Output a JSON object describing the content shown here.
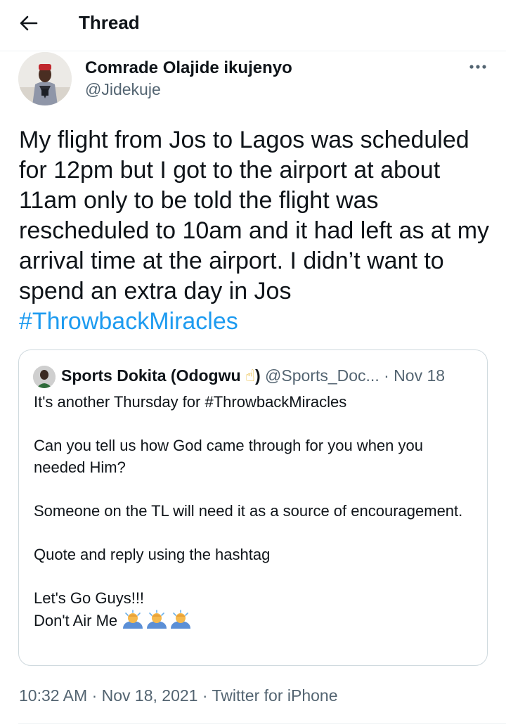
{
  "header": {
    "title": "Thread",
    "back_icon": "arrow-left-icon"
  },
  "tweet": {
    "author_name": "Comrade Olajide ikujenyo",
    "author_handle": "@Jidekuje",
    "more_icon": "more-horizontal-icon",
    "text": "My flight from Jos to Lagos was scheduled for 12pm but I got to the airport at about 11am only to be told the flight was rescheduled to 10am and it had left as at my arrival time at the airport. I didn’t want to spend an extra day in Jos ",
    "hashtag": "#ThrowbackMiracles"
  },
  "quote": {
    "author_name": "Sports Dokita (Odogwu",
    "name_emoji": "☝",
    "name_close": ")",
    "author_handle": "@Sports_Doc...",
    "separator": "·",
    "date": "Nov 18",
    "lines": [
      "It's another Thursday for #ThrowbackMiracles",
      "Can you tell us how God came through for you when you needed Him?",
      "Someone on the TL will need it as a source of encouragement.",
      "Quote and reply using the hashtag"
    ],
    "last_line_1": "Let's Go Guys!!!",
    "last_line_2": "Don't Air Me ",
    "emoji_icon": "man-bowing-emoji-icon"
  },
  "meta": {
    "time": "10:32 AM",
    "separator": "·",
    "date": "Nov 18, 2021",
    "source": "Twitter for iPhone"
  },
  "colors": {
    "link": "#1d9bf0",
    "secondary_text": "#536471",
    "border": "#cfd9de"
  }
}
